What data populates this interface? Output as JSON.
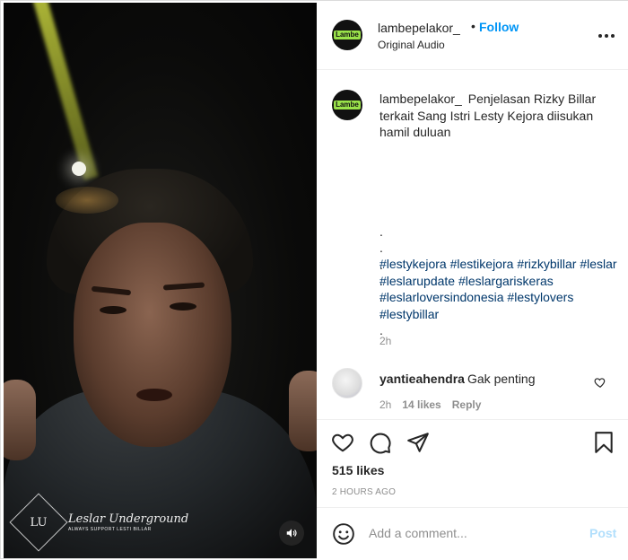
{
  "post": {
    "username": "lambepelakor_",
    "follow_label": "Follow",
    "separator": "•",
    "audio_label": "Original Audio",
    "avatar_badge": "Lambe"
  },
  "caption": {
    "username": "lambepelakor_",
    "text": "Penjelasan Rizky Billar terkait Sang Istri Lesty Kejora diisukan hamil duluan",
    "dots": [
      ".",
      ".",
      ".",
      ".",
      ".",
      ".",
      "."
    ],
    "hashtags": [
      "#lestykejora",
      "#lestikejora",
      "#rizkybillar",
      "#leslar",
      "#leslarupdate",
      "#leslargariskeras",
      "#leslarloversindonesia",
      "#lestylovers",
      "#lestybillar"
    ],
    "time": "2h"
  },
  "comment": {
    "username": "yantieahendra",
    "text": "Gak penting",
    "time": "2h",
    "likes": "14 likes",
    "reply_label": "Reply"
  },
  "engagement": {
    "likes": "515 likes",
    "posted_ago": "2 HOURS AGO"
  },
  "add_comment": {
    "placeholder": "Add a comment...",
    "post_label": "Post",
    "post_color": "#b2dffc"
  },
  "video": {
    "watermark_monogram": "LU",
    "watermark_title": "Leslar Underground",
    "watermark_subtitle": "ALWAYS SUPPORT LESTI BILLAR"
  },
  "colors": {
    "link_blue": "#0095f6",
    "hashtag_blue": "#00376b",
    "muted": "#8e8e8e"
  },
  "icons": [
    "heart-icon",
    "comment-icon",
    "share-icon",
    "bookmark-icon",
    "emoji-icon",
    "volume-icon",
    "more-icon"
  ]
}
